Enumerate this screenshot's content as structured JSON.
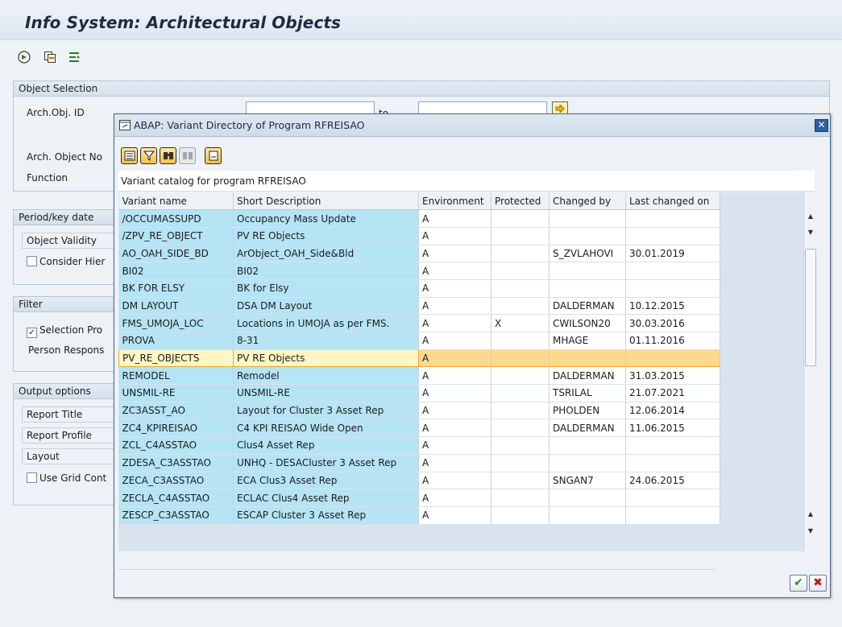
{
  "screen": {
    "title": "Info System: Architectural Objects",
    "toolbar_icons": [
      "execute-icon",
      "copy-icon",
      "selection-options-icon"
    ]
  },
  "object_selection": {
    "header": "Object Selection",
    "arch_obj_id": "Arch.Obj. ID",
    "to_label": "to",
    "arch_object_no": "Arch. Object No",
    "function": "Function"
  },
  "period": {
    "header": "Period/key date",
    "object_validity": "Object Validity",
    "consider_hier": "Consider Hier"
  },
  "filter": {
    "header": "Filter",
    "selection_pro": "Selection Pro",
    "person_respons": "Person Respons"
  },
  "output": {
    "header": "Output options",
    "report_title": "Report Title",
    "report_profile": "Report Profile",
    "layout": "Layout",
    "use_grid": "Use Grid Cont"
  },
  "dialog": {
    "title": "ABAP: Variant Directory of Program RFREISAO",
    "grid_title": "Variant catalog for program RFREISAO",
    "columns": [
      "Variant name",
      "Short Description",
      "Environment",
      "Protected",
      "Changed by",
      "Last changed on"
    ],
    "selected_index": 9,
    "rows": [
      [
        "/OCCUMASSUPD",
        "Occupancy Mass Update",
        "A",
        "",
        "",
        ""
      ],
      [
        "/ZPV_RE_OBJECT",
        "PV RE Objects",
        "A",
        "",
        "",
        ""
      ],
      [
        "AO_OAH_SIDE_BD",
        "ArObject_OAH_Side&Bld",
        "A",
        "",
        "S_ZVLAHOVI",
        "30.01.2019"
      ],
      [
        "BI02",
        "BI02",
        "A",
        "",
        "",
        ""
      ],
      [
        "BK FOR ELSY",
        "BK for Elsy",
        "A",
        "",
        "",
        ""
      ],
      [
        "DM LAYOUT",
        "DSA DM Layout",
        "A",
        "",
        "DALDERMAN",
        "10.12.2015"
      ],
      [
        "FMS_UMOJA_LOC",
        "Locations in UMOJA as per FMS.",
        "A",
        "X",
        "CWILSON20",
        "30.03.2016"
      ],
      [
        "PROVA",
        "8-31",
        "A",
        "",
        "MHAGE",
        "01.11.2016"
      ],
      [
        "PV_RE_OBJECTS",
        "PV RE Objects",
        "A",
        "",
        "",
        ""
      ],
      [
        "REMODEL",
        "Remodel",
        "A",
        "",
        "DALDERMAN",
        "31.03.2015"
      ],
      [
        "UNSMIL-RE",
        "UNSMIL-RE",
        "A",
        "",
        "TSRILAL",
        "21.07.2021"
      ],
      [
        "ZC3ASST_AO",
        "Layout for Cluster 3 Asset Rep",
        "A",
        "",
        "PHOLDEN",
        "12.06.2014"
      ],
      [
        "ZC4_KPIREISAO",
        "C4 KPI REISAO Wide Open",
        "A",
        "",
        "DALDERMAN",
        "11.06.2015"
      ],
      [
        "ZCL_C4ASSTAO",
        "Clus4 Asset Rep",
        "A",
        "",
        "",
        ""
      ],
      [
        "ZDESA_C3ASSTAO",
        "UNHQ - DESACluster 3 Asset Rep",
        "A",
        "",
        "",
        ""
      ],
      [
        "ZECA_C3ASSTAO",
        "ECA Clus3 Asset Rep",
        "A",
        "",
        "SNGAN7",
        "24.06.2015"
      ],
      [
        "ZECLA_C4ASSTAO",
        "ECLAC Clus4 Asset Rep",
        "A",
        "",
        "",
        ""
      ],
      [
        "ZESCP_C3ASSTAO",
        "ESCAP Cluster 3 Asset Rep",
        "A",
        "",
        "",
        ""
      ]
    ],
    "ok_label": "✔",
    "cancel_label": "✖"
  },
  "colors": {
    "key_cell": "#b5e4f5",
    "selected_row": "#fdd98d",
    "title_bar": "#dde7f1",
    "dialog_border": "#4a6a91"
  }
}
